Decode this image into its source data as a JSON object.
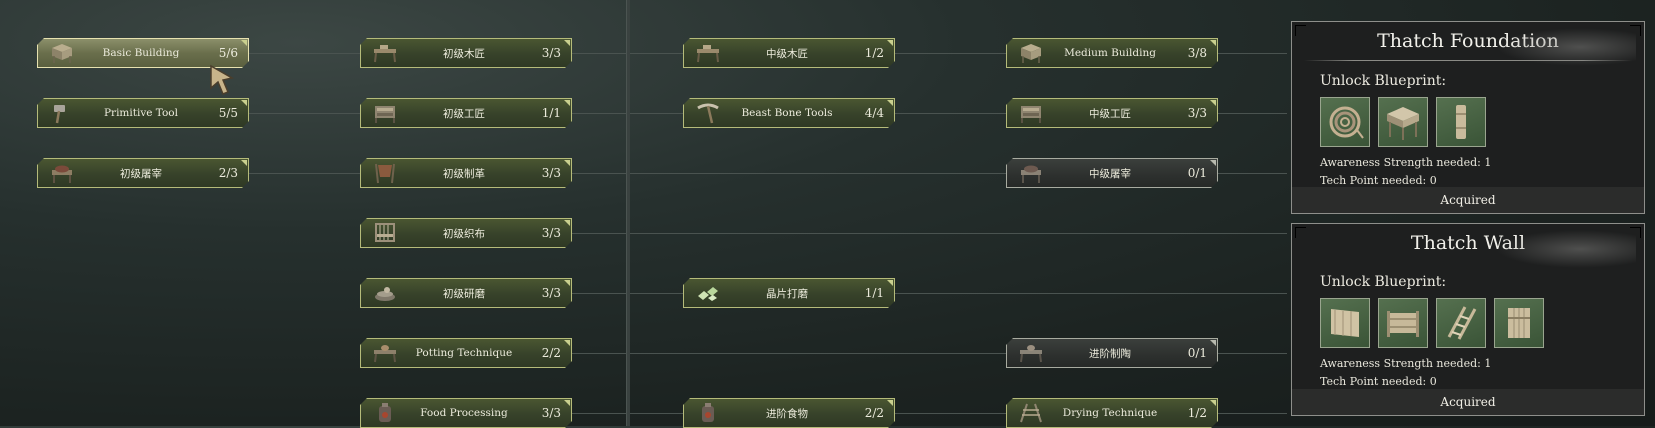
{
  "tree": {
    "nodes": [
      {
        "id": "basic-building",
        "label": "Basic Building",
        "count": "5/6",
        "icon": "building-icon",
        "style": "selected"
      },
      {
        "id": "primitive-tool",
        "label": "Primitive Tool",
        "count": "5/5",
        "icon": "hammer-icon",
        "style": "green"
      },
      {
        "id": "basic-butcher",
        "label": "初级屠宰",
        "count": "2/3",
        "icon": "butcher-table-icon",
        "style": "green"
      },
      {
        "id": "basic-carpentry",
        "label": "初级木匠",
        "count": "3/3",
        "icon": "carpentry-bench-icon",
        "style": "green"
      },
      {
        "id": "basic-workshop",
        "label": "初级工匠",
        "count": "1/1",
        "icon": "workbench-icon",
        "style": "green"
      },
      {
        "id": "basic-tanning",
        "label": "初级制革",
        "count": "3/3",
        "icon": "tanning-rack-icon",
        "style": "green"
      },
      {
        "id": "basic-weaving",
        "label": "初级织布",
        "count": "3/3",
        "icon": "loom-icon",
        "style": "green"
      },
      {
        "id": "basic-grinding",
        "label": "初级研磨",
        "count": "3/3",
        "icon": "grinder-icon",
        "style": "green"
      },
      {
        "id": "potting-technique",
        "label": "Potting Technique",
        "count": "2/2",
        "icon": "pottery-icon",
        "style": "green"
      },
      {
        "id": "food-processing",
        "label": "Food Processing",
        "count": "3/3",
        "icon": "stove-icon",
        "style": "green"
      },
      {
        "id": "mid-carpentry",
        "label": "中级木匠",
        "count": "1/2",
        "icon": "carpentry-bench-icon",
        "style": "green"
      },
      {
        "id": "beast-bone-tools",
        "label": "Beast Bone Tools",
        "count": "4/4",
        "icon": "pickaxe-icon",
        "style": "green"
      },
      {
        "id": "chip-polishing",
        "label": "晶片打磨",
        "count": "1/1",
        "icon": "crystal-chips-icon",
        "style": "green"
      },
      {
        "id": "advanced-food",
        "label": "进阶食物",
        "count": "2/2",
        "icon": "stove-icon",
        "style": "green"
      },
      {
        "id": "medium-building",
        "label": "Medium Building",
        "count": "3/8",
        "icon": "building-icon",
        "style": "green"
      },
      {
        "id": "mid-workshop",
        "label": "中级工匠",
        "count": "3/3",
        "icon": "workbench-icon",
        "style": "green"
      },
      {
        "id": "mid-butcher",
        "label": "中级屠宰",
        "count": "0/1",
        "icon": "butcher-table-icon",
        "style": "gray"
      },
      {
        "id": "advanced-pottery",
        "label": "进阶制陶",
        "count": "0/1",
        "icon": "pottery-icon",
        "style": "gray"
      },
      {
        "id": "drying-technique",
        "label": "Drying Technique",
        "count": "1/2",
        "icon": "drying-rack-icon",
        "style": "green"
      }
    ]
  },
  "panels": [
    {
      "title": "Thatch Foundation",
      "unlock_label": "Unlock Blueprint:",
      "blueprints": [
        "rope-coil-icon",
        "thatch-foundation-icon",
        "wooden-pillar-icon"
      ],
      "awareness": "Awareness Strength needed: 1",
      "tech_point": "Tech Point needed: 0",
      "status": "Acquired"
    },
    {
      "title": "Thatch Wall",
      "unlock_label": "Unlock Blueprint:",
      "blueprints": [
        "thatch-wall-icon",
        "fence-wall-icon",
        "ladder-icon",
        "thatch-door-icon"
      ],
      "awareness": "Awareness Strength needed: 1",
      "tech_point": "Tech Point needed: 0",
      "status": "Acquired"
    }
  ]
}
